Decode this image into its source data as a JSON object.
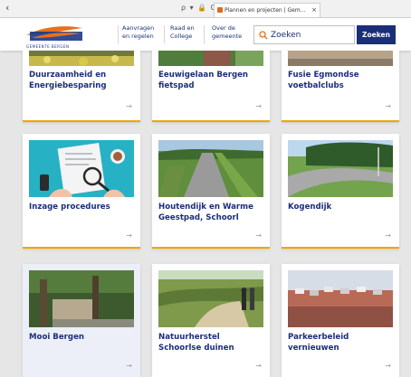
{
  "browser": {
    "back_glyph": "‹",
    "nav_icons": "ρ ▾ 🔒 C",
    "tab_title": "Plannen en projecten | Gem...",
    "tab_close": "×"
  },
  "header": {
    "logo_subtext": "GEMEENTE BERGEN",
    "nav": [
      {
        "line1": "Aanvragen",
        "line2": "en regelen"
      },
      {
        "line1": "Raad en",
        "line2": "College"
      },
      {
        "line1": "Over de",
        "line2": "gemeente"
      }
    ],
    "search_placeholder": "Zoeken",
    "search_button": "Zoeken"
  },
  "colors": {
    "brand_blue": "#1b2e7a",
    "accent_orange": "#f0a500",
    "logo_orange": "#e8701a"
  },
  "arrow_glyph": "→",
  "cards": [
    {
      "title_line1": "Duurzaamheid en",
      "title_line2": "Energiebesparing"
    },
    {
      "title_line1": "Eeuwigelaan Bergen",
      "title_line2": "fietspad"
    },
    {
      "title_line1": "Fusie Egmondse",
      "title_line2": "voetbalclubs"
    },
    {
      "title_line1": "Inzage procedures",
      "title_line2": ""
    },
    {
      "title_line1": "Houtendijk en Warme",
      "title_line2": "Geestpad, Schoorl"
    },
    {
      "title_line1": "Kogendijk",
      "title_line2": ""
    },
    {
      "title_line1": "Mooi Bergen",
      "title_line2": ""
    },
    {
      "title_line1": "Natuurherstel",
      "title_line2": "Schoorlse duinen"
    },
    {
      "title_line1": "Parkeerbeleid",
      "title_line2": "vernieuwen"
    }
  ]
}
